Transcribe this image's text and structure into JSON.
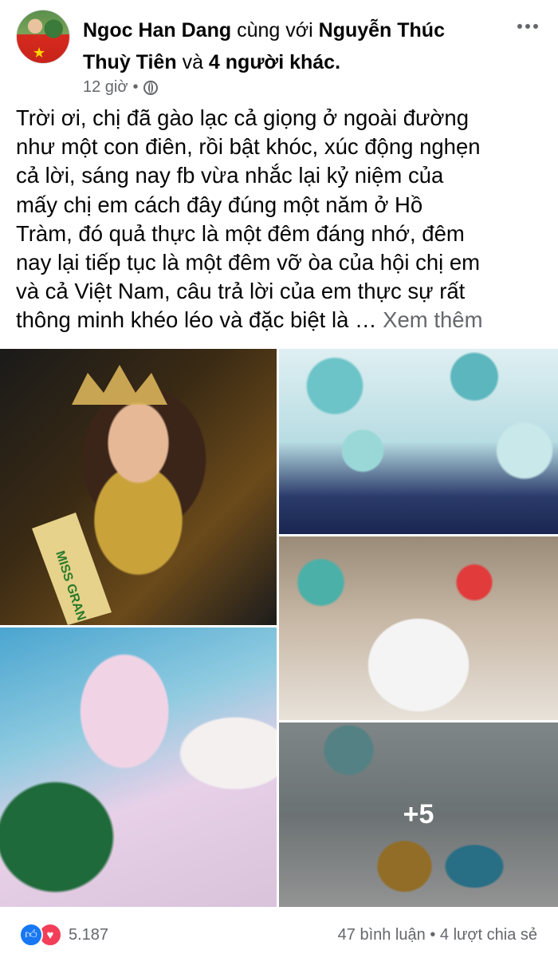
{
  "post": {
    "author_name": "Ngoc Han Dang",
    "with_text": "cùng với",
    "tagged_person": "Nguyễn Thúc Thuỳ Tiên",
    "and_text": "và",
    "others": "4 người khác.",
    "timestamp": "12 giờ",
    "meta_separator": "•",
    "privacy_icon": "globe-icon",
    "body": "Trời ơi, chị đã gào lạc cả giọng ở ngoài đường\nnhư một con điên, rồi bật khóc, xúc động nghẹn\ncả lời, sáng nay fb vừa nhắc lại kỷ niệm của\nmấy chị em cách đây đúng một năm ở Hồ\nTràm, đó quả thực là một đêm đáng nhớ, đêm\nnay lại tiếp tục là một đêm vỡ òa của hội chị em\nvà cả Việt Nam, câu trả lời của em thực sự rất\nthông minh khéo léo và đặc biệt là … ",
    "see_more": "Xem thêm"
  },
  "photos": {
    "more_count": "+5",
    "sash_text": "MISS GRAN"
  },
  "footer": {
    "reaction_icons": [
      "like-icon",
      "love-icon"
    ],
    "reaction_count": "5.187",
    "comments": "47 bình luận",
    "separator": "•",
    "shares": "4 lượt chia sẻ"
  },
  "colors": {
    "primary_text": "#050505",
    "secondary_text": "#65676b",
    "like_blue": "#1877f2",
    "love_red": "#f33e58"
  }
}
